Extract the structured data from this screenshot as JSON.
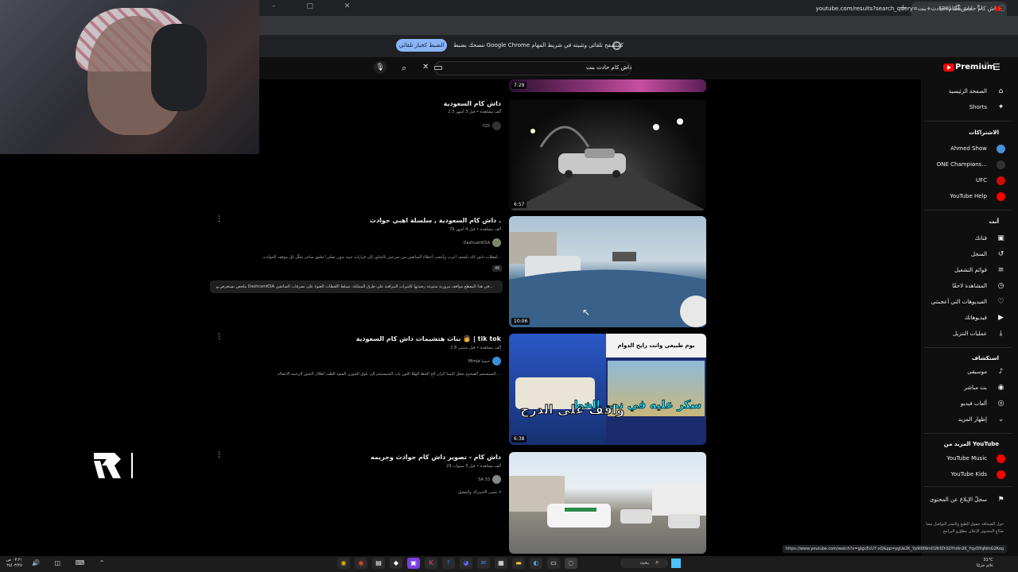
{
  "browser": {
    "tab_title": "(30) داش كام حادث بنت -",
    "url": "youtube.com/results?search_query=داش+كام+حادث+بنت",
    "notification_text": "ننصحك بضبط Google Chrome كمتصفح تلقائي وتثبيته في شريط المهام",
    "notification_button": "الضبط كخيار تلقائي",
    "status_url": "https://www.youtube.com/watch?v=gIgcEcU7-xQ&pp=ygUe2K_Yp9i0INmD2KfZhSDYrdin2K_YqyDYqNmG2Kog"
  },
  "youtube": {
    "logo_text": "Premium",
    "logo_region": "SA",
    "search_query": "داش كام حادث بنت"
  },
  "sidebar": {
    "main": [
      {
        "label": "الصفحة الرئيسية",
        "icon": "home-icon",
        "glyph": "⌂"
      },
      {
        "label": "Shorts",
        "icon": "shorts-icon",
        "glyph": "✦"
      }
    ],
    "subscriptions_header": "الاشتراكات",
    "subscriptions": [
      {
        "label": "Ahmed Show",
        "color": "#4a90d9"
      },
      {
        "label": "ONE Champions...",
        "color": "#333333"
      },
      {
        "label": "UFC",
        "color": "#d20a0a"
      },
      {
        "label": "YouTube Help",
        "color": "#ff0000"
      }
    ],
    "you_header": "أنت",
    "you": [
      {
        "label": "قناتك",
        "icon": "channel-icon",
        "glyph": "▣"
      },
      {
        "label": "السجل",
        "icon": "history-icon",
        "glyph": "↺"
      },
      {
        "label": "قوائم التشغيل",
        "icon": "playlists-icon",
        "glyph": "≡"
      },
      {
        "label": "المشاهدة لاحقًا",
        "icon": "watch-later-icon",
        "glyph": "◷"
      },
      {
        "label": "الفيديوهات التي أعجبتني",
        "icon": "like-icon",
        "glyph": "👍"
      },
      {
        "label": "فيديوهاتك",
        "icon": "your-videos-icon",
        "glyph": "▶"
      },
      {
        "label": "عمليات التنزيل",
        "icon": "download-icon",
        "glyph": "⤓"
      }
    ],
    "explore_header": "استكشاف",
    "explore": [
      {
        "label": "موسيقى",
        "icon": "music-icon",
        "glyph": "♪"
      },
      {
        "label": "بث مباشر",
        "icon": "live-icon",
        "glyph": "◉"
      },
      {
        "label": "ألعاب فيديو",
        "icon": "gaming-icon",
        "glyph": "◎"
      },
      {
        "label": "إظهار المزيد",
        "icon": "chevron-down-icon",
        "glyph": "⌄"
      }
    ],
    "more_header": "المزيد من YouTube",
    "more": [
      {
        "label": "YouTube Music",
        "color": "#ff0000"
      },
      {
        "label": "YouTube Kids",
        "color": "#ff0000"
      }
    ],
    "report_label": "سجلّ الإبلاغ عن المحتوى",
    "footer": "حول  الصحافة  حقوق الطبع والنشر  التواصل معنا  صنّاع المحتوى  الإعلان  مطوّرو البرامج"
  },
  "results": [
    {
      "title": "داش كام السعودية",
      "meta": "2.3 ألف مشاهدة • قبل 3 أشهر",
      "channel": "Y20",
      "duration": "6:57",
      "description": ""
    },
    {
      "title": "داش كام السعودية , سلسلة اهبي حوادث .",
      "meta": "79 ألف مشاهدة • قبل 4 أشهر",
      "channel": "DashcamKSA",
      "duration": "10:06",
      "description": "لقطات داش كام تكشف أغرب وأعجب أخطاء السائقين من سرعتن بالتجاوز إلى قرارات غبية بدون تفكير! تعليق ساخر يحلّل كل موقف الحوادث...",
      "badge": "4K",
      "key_moments": "ملخص  يستعرض DashcamKSA في هذا المقطع مواقف مرورية متنوعة رصدتها كاميرات المراقبة على طرق المملكة، تسلط اللقطات الضوء على تصرفات السائقين..."
    },
    {
      "title": "بنات هتشيمات داش كام السعودية 👩 | tik tok",
      "meta": "2.8 ألف مشاهدة • قبل سنتين",
      "channel": "Mimja حبيبيا",
      "duration": "6:38",
      "description": "السيستمم الصحيح بجعل اليسا الزان الخ الحظ الهللا اللون باب السيستمم إلى بلوق الجوزن السود الطب اطلال التحور الرحمة الانصالة ..."
    },
    {
      "title": "داش كام - تصوير داش كام حوادث وجريمه",
      "meta": "29 ألف مشاهدة • قبل 3 سنوات",
      "channel": "SA 33",
      "duration": "",
      "description": "لا تنسى الاشتراك والتفعيل"
    }
  ],
  "thumb3_text": {
    "top": "يوم طبيعي وانت رايح الدوام",
    "right": "سكر عليه في نص الخط",
    "left": "واقف على الدرج"
  },
  "prev_duration": "7:29",
  "taskbar": {
    "clock": "٠٣:٢١ ص",
    "date": "٢٥/٠٣/٢٥",
    "search_label": "بحث",
    "weather_temp": "31°C",
    "weather_desc": "غائم جزئيًا"
  },
  "colors": {
    "accent": "#ff0000",
    "link": "#8ab4f8"
  }
}
